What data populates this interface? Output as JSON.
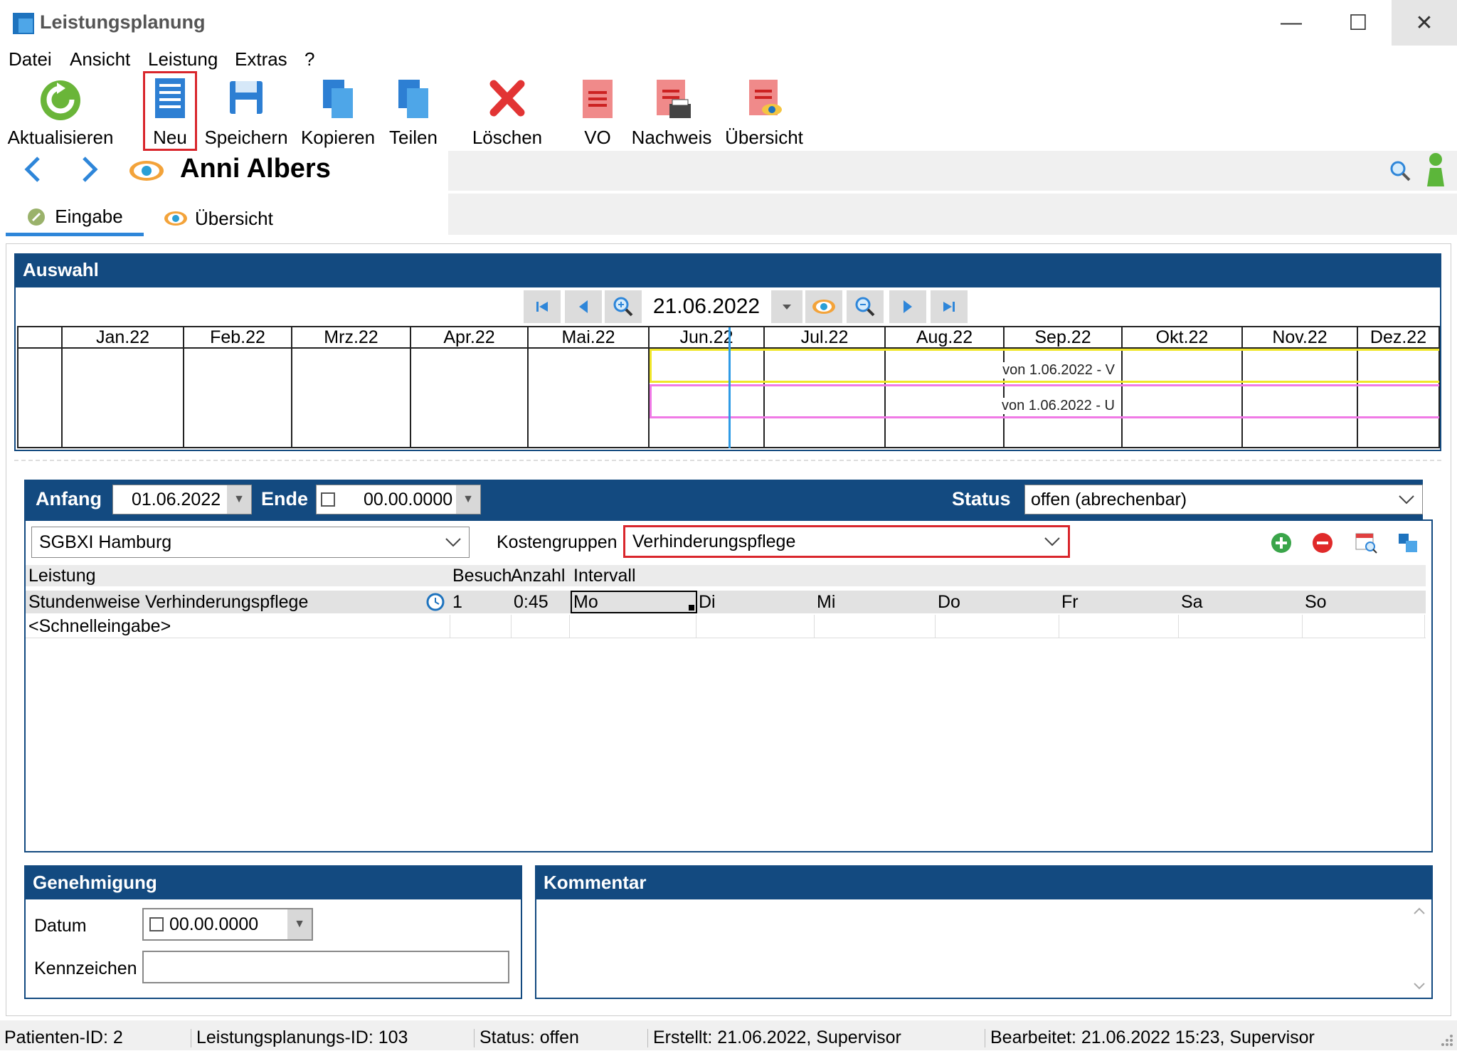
{
  "window": {
    "title": "Leistungsplanung"
  },
  "menu": [
    "Datei",
    "Ansicht",
    "Leistung",
    "Extras",
    "?"
  ],
  "toolbar": {
    "refresh": "Aktualisieren",
    "new": "Neu",
    "save": "Speichern",
    "copy": "Kopieren",
    "split": "Teilen",
    "delete": "Löschen",
    "vo": "VO",
    "proof": "Nachweis",
    "overview": "Übersicht"
  },
  "patient": {
    "name": "Anni Albers"
  },
  "tabs": {
    "input": "Eingabe",
    "overview": "Übersicht"
  },
  "selection": {
    "header": "Auswahl",
    "date": "21.06.2022",
    "months": [
      "Jan.22",
      "Feb.22",
      "Mrz.22",
      "Apr.22",
      "Mai.22",
      "Jun.22",
      "Jul.22",
      "Aug.22",
      "Sep.22",
      "Okt.22",
      "Nov.22",
      "Dez.22"
    ],
    "bars": [
      {
        "label": "von 1.06.2022 - V",
        "color": "#f0e62a"
      },
      {
        "label": "von 1.06.2022 - U",
        "color": "#f07ae6"
      }
    ]
  },
  "period": {
    "start_label": "Anfang",
    "start_value": "01.06.2022",
    "end_label": "Ende",
    "end_value": "00.00.0000",
    "status_label": "Status",
    "status_value": "offen (abrechenbar)"
  },
  "filters": {
    "payer": "SGBXI Hamburg",
    "cost_groups_label": "Kostengruppen",
    "cost_groups_value": "Verhinderungspflege"
  },
  "grid": {
    "columns": {
      "service": "Leistung",
      "visit": "Besuch",
      "count": "Anzahl",
      "interval": "Intervall"
    },
    "row": {
      "service": "Stundenweise Verhinderungspflege",
      "visit": "1",
      "duration": "0:45",
      "days": [
        "Mo",
        "Di",
        "Mi",
        "Do",
        "Fr",
        "Sa",
        "So"
      ]
    },
    "quick_entry": "<Schnelleingabe>"
  },
  "approval": {
    "header": "Genehmigung",
    "date_label": "Datum",
    "date_value": "00.00.0000",
    "mark_label": "Kennzeichen",
    "mark_value": ""
  },
  "comment": {
    "header": "Kommentar",
    "value": ""
  },
  "statusbar": {
    "patient_id": "Patienten-ID: 2",
    "plan_id": "Leistungsplanungs-ID: 103",
    "status": "Status: offen",
    "created": "Erstellt: 21.06.2022, Supervisor",
    "edited": "Bearbeitet: 21.06.2022 15:23, Supervisor"
  },
  "colors": {
    "header_blue": "#134a80",
    "accent_blue": "#2e86d9",
    "highlight_red": "#d9262c"
  }
}
